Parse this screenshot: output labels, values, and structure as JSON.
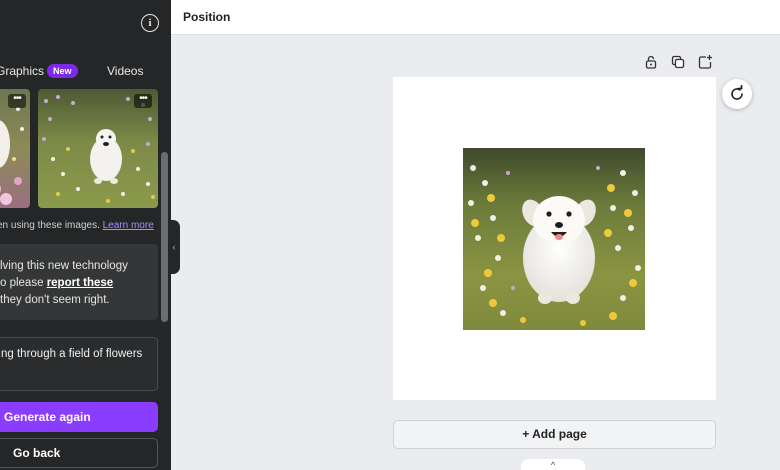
{
  "panel": {
    "tabs": {
      "graphics": "Graphics",
      "new_badge": "New",
      "videos": "Videos"
    },
    "thumb_more": "•••",
    "disclaimer": {
      "text": "en using these images.",
      "link": "Learn more"
    },
    "notice": {
      "line1": "lving this new technology",
      "line2_prefix": "o please ",
      "line2_link": "report these",
      "line3": "they don't seem right."
    },
    "prompt": "ng through a field of flowers",
    "generate_label": "Generate again",
    "back_label": "Go back",
    "collapse_glyph": "‹"
  },
  "topbar": {
    "title": "Position"
  },
  "canvas": {
    "add_page_label": "+ Add page",
    "handle_glyph": "^"
  },
  "icons": {
    "info": "info-icon",
    "lock": "lock-icon",
    "duplicate": "duplicate-icon",
    "add_page": "add-page-icon",
    "refresh": "refresh-icon"
  },
  "colors": {
    "panel_bg": "#252627",
    "accent": "#8b3dff",
    "canvas_bg": "#ebecf0"
  }
}
